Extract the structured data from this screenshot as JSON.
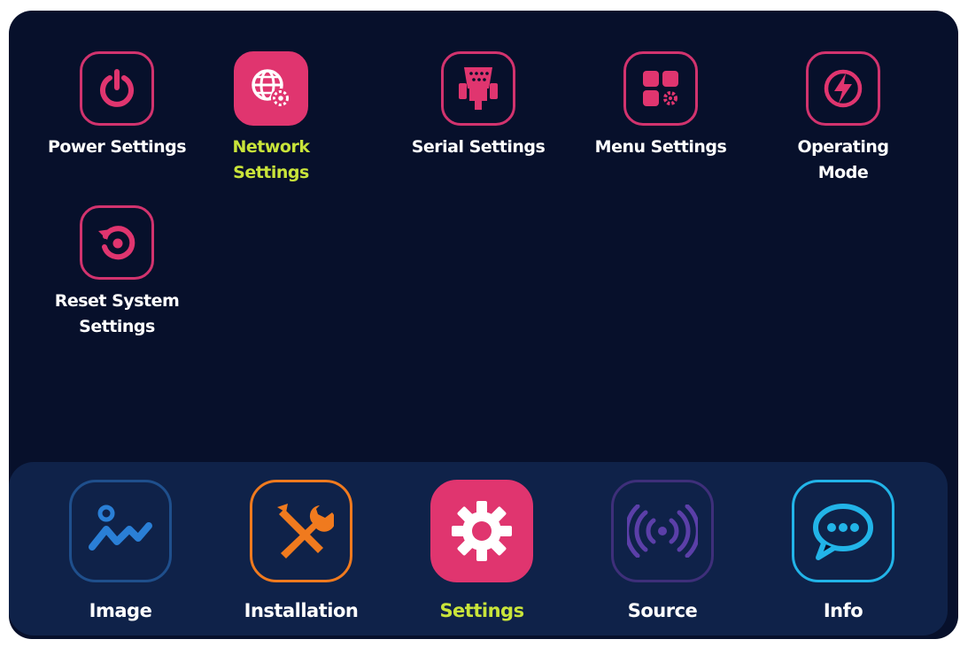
{
  "settings_menu": {
    "items": [
      {
        "id": "power",
        "label": "Power Settings",
        "icon": "power-icon"
      },
      {
        "id": "network",
        "label": "Network\nSettings",
        "icon": "network-globe-icon",
        "selected": true
      },
      {
        "id": "serial",
        "label": "Serial Settings",
        "icon": "serial-port-icon"
      },
      {
        "id": "menu",
        "label": "Menu Settings",
        "icon": "menu-grid-icon"
      },
      {
        "id": "operating",
        "label": "Operating\nMode",
        "icon": "lightning-icon"
      },
      {
        "id": "reset",
        "label": "Reset System\nSettings",
        "icon": "reset-icon"
      }
    ]
  },
  "bottom_nav": {
    "items": [
      {
        "label": "Image",
        "icon": "image-chart-icon",
        "color": "#2a7fd6"
      },
      {
        "label": "Installation",
        "icon": "tools-icon",
        "color": "#f07a1e"
      },
      {
        "label": "Settings",
        "icon": "gear-icon",
        "color": "#e0356f",
        "active": true
      },
      {
        "label": "Source",
        "icon": "broadcast-icon",
        "color": "#5b3fa8"
      },
      {
        "label": "Info",
        "icon": "chat-bubble-icon",
        "color": "#22b4e8"
      }
    ]
  },
  "colors": {
    "background": "#07102b",
    "bottom_bar": "#0f2249",
    "accent_pink": "#e0356f",
    "selected_text": "#c9e43a"
  }
}
